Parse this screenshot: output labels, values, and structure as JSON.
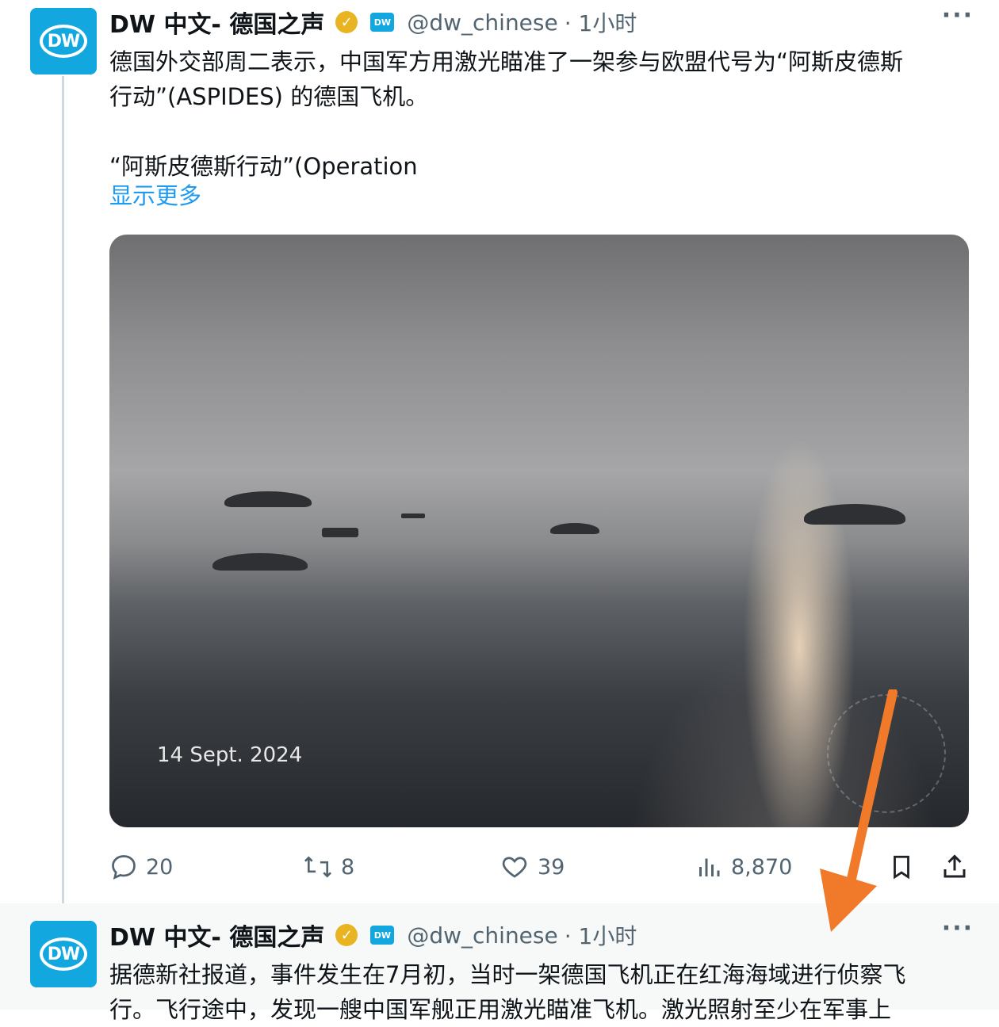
{
  "tweets": [
    {
      "author_name": "DW 中文- 德国之声",
      "handle": "@dw_chinese",
      "time": "· 1小时",
      "avatar_text": "DW",
      "more": "···",
      "text": "德国外交部周二表示，中国军方用激光瞄准了一架参与欧盟代号为“阿斯皮德斯\n行动”(ASPIDES) 的德国飞机。\n\n“阿斯皮德斯行动”(Operation",
      "show_more": "显示更多",
      "media": {
        "date_overlay": "14 Sept. 2024"
      },
      "actions": {
        "replies": "20",
        "retweets": "8",
        "likes": "39",
        "views": "8,870"
      }
    },
    {
      "author_name": "DW 中文- 德国之声",
      "handle": "@dw_chinese",
      "time": "· 1小时",
      "avatar_text": "DW",
      "more": "···",
      "text": "据德新社报道，事件发生在7月初，当时一架德国飞机正在红海海域进行侦察飞\n行。飞行途中，发现一艘中国军舰正用激光瞄准飞机。激光照射至少在军事上"
    }
  ],
  "colors": {
    "accent": "#1d9bf0",
    "dw_blue": "#12a7df",
    "gold_badge": "#e8b422",
    "arrow": "#f07a2a",
    "secondary_text": "#536471"
  }
}
